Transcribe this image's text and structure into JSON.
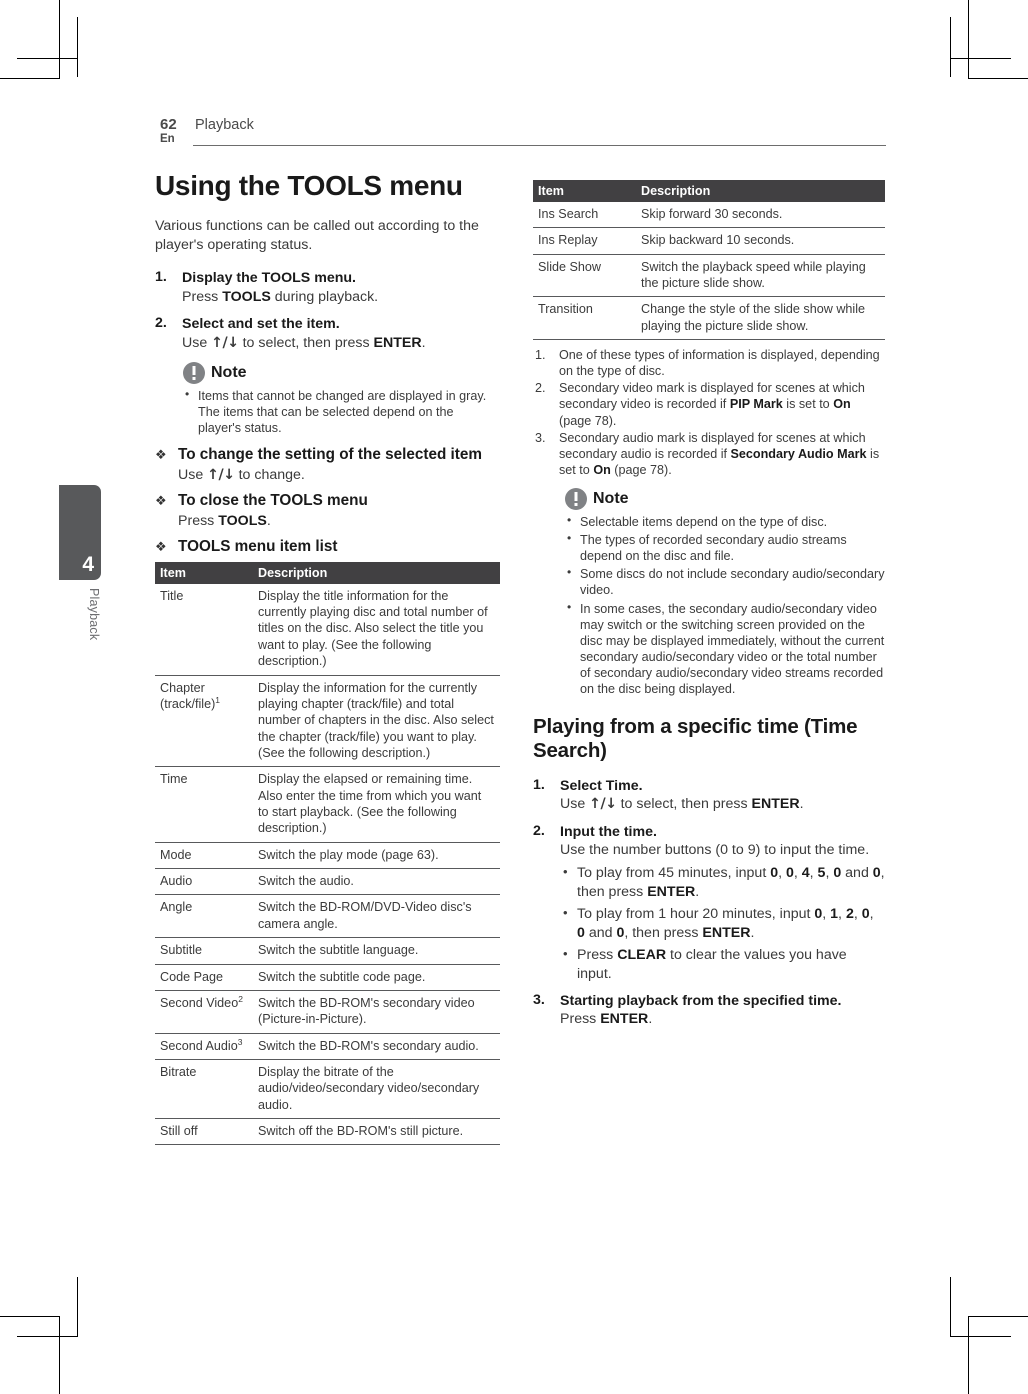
{
  "page": {
    "number": "62",
    "language": "En",
    "section": "Playback",
    "tab_number": "4",
    "tab_label": "Playback"
  },
  "left": {
    "title": "Using the TOOLS menu",
    "intro": "Various functions can be called out according to the player's operating status.",
    "steps": [
      {
        "num": "1.",
        "head_a": "Display the ",
        "head_kw": "TOOLS",
        "head_b": " menu.",
        "sub_a": "Press ",
        "sub_kw": "TOOLS",
        "sub_b": " during playback."
      },
      {
        "num": "2.",
        "head": "Select and set the item.",
        "sub_a": "Use ",
        "sub_arrow": "↑/↓",
        "sub_b": " to select, then press ",
        "sub_kw": "ENTER",
        "sub_c": "."
      }
    ],
    "note": {
      "title": "Note",
      "items": [
        "Items that cannot be changed are displayed in gray. The items that can be selected depend on the player's status."
      ]
    },
    "diamonds": [
      {
        "title": "To change the setting of the selected item",
        "body_a": "Use ",
        "body_arrow": "↑/↓",
        "body_b": " to change."
      },
      {
        "title": "To close the TOOLS menu",
        "body_a": "Press ",
        "body_kw": "TOOLS",
        "body_b": "."
      },
      {
        "title": "TOOLS menu item list"
      }
    ],
    "table": {
      "headers": [
        "Item",
        "Description"
      ],
      "rows": [
        [
          "Title",
          "Display the title information for the currently playing disc and total number of titles on the disc. Also select the title you want to play. (See the following description.)"
        ],
        [
          "Chapter (track/file)¹",
          "Display the information for the currently playing chapter (track/file) and total number of chapters in the disc. Also select the chapter (track/file) you want to play. (See the following description.)"
        ],
        [
          "Time",
          "Display the elapsed or remaining time.\nAlso enter the time from which you want to start playback. (See the following description.)"
        ],
        [
          "Mode",
          "Switch the play mode (page 63)."
        ],
        [
          "Audio",
          "Switch the audio."
        ],
        [
          "Angle",
          "Switch the BD-ROM/DVD-Video disc's camera angle."
        ],
        [
          "Subtitle",
          "Switch the subtitle language."
        ],
        [
          "Code Page",
          "Switch the subtitle code page."
        ],
        [
          "Second Video²",
          "Switch the BD-ROM's secondary video (Picture-in-Picture)."
        ],
        [
          "Second Audio³",
          "Switch the BD-ROM's secondary audio."
        ],
        [
          "Bitrate",
          "Display the bitrate of the audio/video/secondary video/secondary audio."
        ],
        [
          "Still off",
          "Switch off the BD-ROM's still picture."
        ]
      ]
    }
  },
  "right": {
    "table": {
      "headers": [
        "Item",
        "Description"
      ],
      "rows": [
        [
          "Ins Search",
          "Skip forward 30 seconds."
        ],
        [
          "Ins Replay",
          "Skip backward 10 seconds."
        ],
        [
          "Slide Show",
          "Switch the playback speed while playing the picture slide show."
        ],
        [
          "Transition",
          "Change the style of the slide show while playing the picture slide show."
        ]
      ]
    },
    "footnotes": [
      {
        "num": "1.",
        "a": "One of these types of information is displayed, depending on the type of disc.",
        "kw1": "",
        "b": "",
        "kw2": "",
        "c": ""
      },
      {
        "num": "2.",
        "a": "Secondary video mark is displayed for scenes at which secondary video is recorded if ",
        "kw1": "PIP Mark",
        "b": " is set to ",
        "kw2": "On",
        "c": " (page 78)."
      },
      {
        "num": "3.",
        "a": "Secondary audio mark is displayed for scenes at which secondary audio is recorded if ",
        "kw1": "Secondary Audio Mark",
        "b": " is set to ",
        "kw2": "On",
        "c": " (page 78)."
      }
    ],
    "note": {
      "title": "Note",
      "items": [
        "Selectable items depend on the type of disc.",
        "The types of recorded secondary audio streams depend on the disc and file.",
        "Some discs do not include secondary audio/secondary video.",
        "In some cases, the secondary audio/secondary video may switch or the switching screen provided on the disc may be displayed immediately, without the current secondary audio/secondary video or the total number of secondary audio/secondary video streams recorded on the disc being displayed."
      ]
    },
    "section2": {
      "title": "Playing from a specific time (Time Search)",
      "steps": [
        {
          "num": "1.",
          "head": "Select Time.",
          "sub_a": "Use ",
          "sub_arrow": "↑/↓",
          "sub_b": " to select, then press ",
          "sub_kw": "ENTER",
          "sub_c": "."
        },
        {
          "num": "2.",
          "head": "Input the time.",
          "sub": "Use the number buttons (0 to 9) to input the time."
        },
        {
          "num": "3.",
          "head": "Starting playback from the specified time.",
          "sub_a": "Press ",
          "sub_kw": "ENTER",
          "sub_b": "."
        }
      ],
      "bullets": [
        {
          "a": "To play from 45 minutes, input ",
          "k": [
            "0",
            "0",
            "4",
            "5",
            "0",
            "0"
          ],
          "b": ", then press ",
          "kw": "ENTER",
          "c": "."
        },
        {
          "a": "To play from 1 hour 20 minutes, input ",
          "k": [
            "0",
            "1",
            "2",
            "0",
            "0",
            "0"
          ],
          "b": ", then press ",
          "kw": "ENTER",
          "c": "."
        },
        {
          "a": "Press ",
          "kw": "CLEAR",
          "b": " to clear the values you have input."
        }
      ]
    }
  },
  "colors": {
    "table_header_bg": "#414042",
    "tab_bg": "#58595b",
    "rule": "#6d6d6d",
    "text": "#3b3b3b"
  }
}
